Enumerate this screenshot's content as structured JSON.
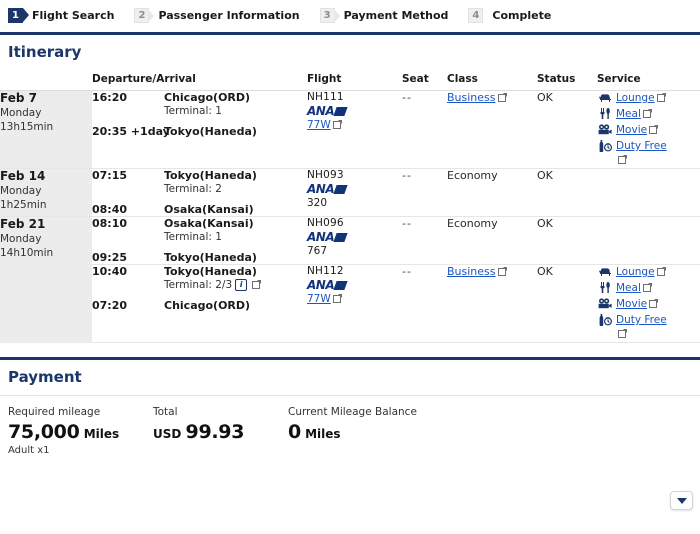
{
  "steps": [
    {
      "num": "1",
      "label": "Flight Search",
      "active": true
    },
    {
      "num": "2",
      "label": "Passenger Information",
      "active": false
    },
    {
      "num": "3",
      "label": "Payment Method",
      "active": false
    },
    {
      "num": "4",
      "label": "Complete",
      "active": false
    }
  ],
  "itinerary": {
    "title": "Itinerary",
    "columns": {
      "date": "",
      "departure_arrival": "Departure/Arrival",
      "flight": "Flight",
      "seat": "Seat",
      "class": "Class",
      "status": "Status",
      "service": "Service"
    },
    "rows": [
      {
        "date": "Feb 7",
        "weekday": "Monday",
        "duration": "13h15min",
        "dep_time": "16:20",
        "dep_place": "Chicago(ORD)",
        "dep_terminal": "Terminal: 1",
        "arr_time": "20:35 +1day",
        "arr_place": "Tokyo(Haneda)",
        "arr_terminal": "",
        "flight_no": "NH111",
        "carrier": "ANA",
        "equipment": "77W",
        "equipment_is_link": true,
        "seat": "--",
        "class": "Business",
        "class_is_link": true,
        "status": "OK",
        "services": [
          {
            "icon": "lounge-icon",
            "label": "Lounge"
          },
          {
            "icon": "meal-icon",
            "label": "Meal"
          },
          {
            "icon": "movie-icon",
            "label": "Movie"
          },
          {
            "icon": "duty-free-icon",
            "label": "Duty Free"
          }
        ]
      },
      {
        "date": "Feb 14",
        "weekday": "Monday",
        "duration": "1h25min",
        "dep_time": "07:15",
        "dep_place": "Tokyo(Haneda)",
        "dep_terminal": "Terminal: 2",
        "arr_time": "08:40",
        "arr_place": "Osaka(Kansai)",
        "arr_terminal": "",
        "flight_no": "NH093",
        "carrier": "ANA",
        "equipment": "320",
        "equipment_is_link": false,
        "seat": "--",
        "class": "Economy",
        "class_is_link": false,
        "status": "OK",
        "services": []
      },
      {
        "date": "Feb 21",
        "weekday": "Monday",
        "duration": "14h10min",
        "dep_time": "08:10",
        "dep_place": "Osaka(Kansai)",
        "dep_terminal": "Terminal: 1",
        "arr_time": "09:25",
        "arr_place": "Tokyo(Haneda)",
        "arr_terminal": "",
        "flight_no": "NH096",
        "carrier": "ANA",
        "equipment": "767",
        "equipment_is_link": false,
        "seat": "--",
        "class": "Economy",
        "class_is_link": false,
        "status": "OK",
        "services": []
      },
      {
        "date": "",
        "weekday": "",
        "duration": "",
        "dep_time": "10:40",
        "dep_place": "Tokyo(Haneda)",
        "dep_terminal": "Terminal: 2/3",
        "dep_terminal_has_info": true,
        "arr_time": "07:20",
        "arr_place": "Chicago(ORD)",
        "arr_terminal": "",
        "flight_no": "NH112",
        "carrier": "ANA",
        "equipment": "77W",
        "equipment_is_link": true,
        "seat": "--",
        "class": "Business",
        "class_is_link": true,
        "status": "OK",
        "services": [
          {
            "icon": "lounge-icon",
            "label": "Lounge"
          },
          {
            "icon": "meal-icon",
            "label": "Meal"
          },
          {
            "icon": "movie-icon",
            "label": "Movie"
          },
          {
            "icon": "duty-free-icon",
            "label": "Duty Free"
          }
        ]
      }
    ]
  },
  "payment": {
    "title": "Payment",
    "required_mileage_label": "Required mileage",
    "required_mileage_value": "75,000",
    "required_mileage_unit": "Miles",
    "passenger_note": "Adult x1",
    "total_label": "Total",
    "total_currency": "USD",
    "total_value": "99.93",
    "balance_label": "Current Mileage Balance",
    "balance_value": "0",
    "balance_unit": "Miles"
  },
  "colors": {
    "brand_navy": "#1b3668",
    "link_blue": "#1a56c4",
    "date_cell_bg": "#ececec"
  }
}
